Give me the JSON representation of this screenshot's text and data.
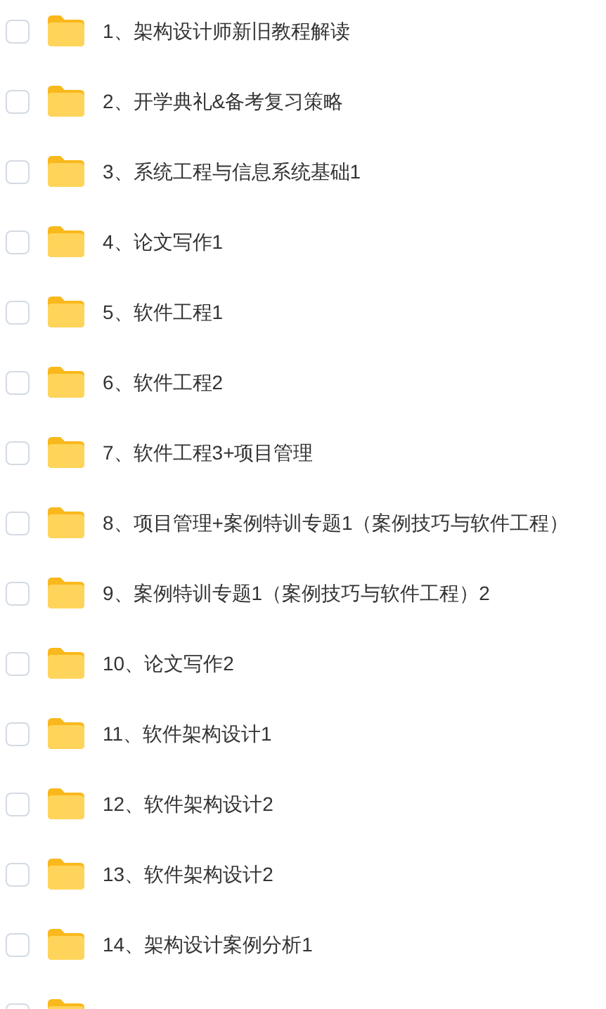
{
  "folders": [
    {
      "label": "1、架构设计师新旧教程解读",
      "checked": false
    },
    {
      "label": "2、开学典礼&备考复习策略",
      "checked": false
    },
    {
      "label": "3、系统工程与信息系统基础1",
      "checked": false
    },
    {
      "label": "4、论文写作1",
      "checked": false
    },
    {
      "label": "5、软件工程1",
      "checked": false
    },
    {
      "label": "6、软件工程2",
      "checked": false
    },
    {
      "label": "7、软件工程3+项目管理",
      "checked": false
    },
    {
      "label": "8、项目管理+案例特训专题1（案例技巧与软件工程）",
      "checked": false
    },
    {
      "label": "9、案例特训专题1（案例技巧与软件工程）2",
      "checked": false
    },
    {
      "label": "10、论文写作2",
      "checked": false
    },
    {
      "label": "11、软件架构设计1",
      "checked": false
    },
    {
      "label": "12、软件架构设计2",
      "checked": false
    },
    {
      "label": "13、软件架构设计2",
      "checked": false
    },
    {
      "label": "14、架构设计案例分析1",
      "checked": false
    },
    {
      "checked": false
    }
  ]
}
